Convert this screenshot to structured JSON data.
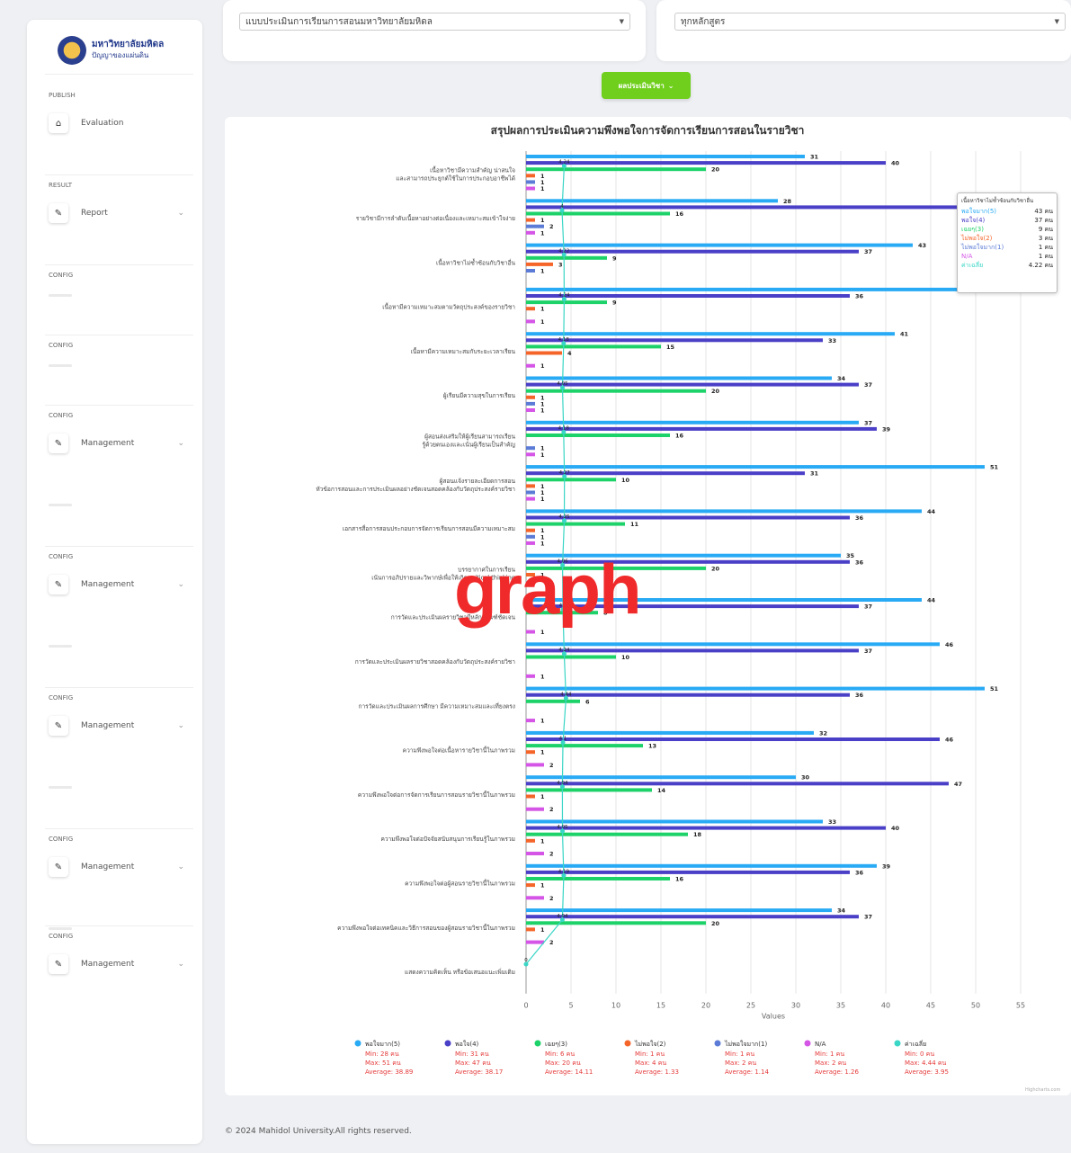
{
  "sidebar": {
    "logo_title": "มหาวิทยาลัยมหิดล",
    "logo_sub": "ปัญญาของแผ่นดิน",
    "sections": [
      {
        "label": "PUBLISH",
        "item": "Evaluation",
        "icon": "home-icon",
        "chevron": false,
        "ghost": false
      },
      {
        "label": "RESULT",
        "item": "Report",
        "icon": "tool-icon",
        "chevron": true,
        "ghost": false
      },
      {
        "label": "CONFIG",
        "item": "",
        "icon": "",
        "chevron": false,
        "ghost": true
      },
      {
        "label": "CONFIG",
        "item": "",
        "icon": "",
        "chevron": false,
        "ghost": true
      },
      {
        "label": "CONFIG",
        "item": "Management",
        "icon": "tool-icon",
        "chevron": true,
        "ghost": true
      },
      {
        "label": "CONFIG",
        "item": "Management",
        "icon": "tool-icon",
        "chevron": true,
        "ghost": true
      },
      {
        "label": "CONFIG",
        "item": "Management",
        "icon": "tool-icon",
        "chevron": true,
        "ghost": true
      },
      {
        "label": "CONFIG",
        "item": "Management",
        "icon": "tool-icon",
        "chevron": true,
        "ghost": true
      },
      {
        "label": "CONFIG",
        "item": "Management",
        "icon": "tool-icon",
        "chevron": true,
        "ghost": false
      }
    ]
  },
  "filters": {
    "form_select": "แบบประเมินการเรียนการสอนมหาวิทยาลัยมหิดล",
    "course_select": "ทุกหลักสูตร"
  },
  "button_label": "ผลประเมินวิชา",
  "overlay_text": "graph",
  "footer": "© 2024 Mahidol University.All rights reserved.",
  "credit": "Highcharts.com",
  "tooltip": {
    "title": "เนื้อหาวิชาไม่ซ้ำซ้อนกับวิชาอื่น",
    "rows": [
      {
        "label": "พอใจมาก(5)",
        "value": "43 คน",
        "color": "#29aaf4"
      },
      {
        "label": "พอใจ(4)",
        "value": "37 คน",
        "color": "#4a3fc7"
      },
      {
        "label": "เฉยๆ(3)",
        "value": "9 คน",
        "color": "#1ed26a"
      },
      {
        "label": "ไม่พอใจ(2)",
        "value": "3 คน",
        "color": "#f5652a"
      },
      {
        "label": "ไม่พอใจมาก(1)",
        "value": "1 คน",
        "color": "#5b7bd6"
      },
      {
        "label": "N/A",
        "value": "1 คน",
        "color": "#d455e6"
      },
      {
        "label": "ค่าเฉลี่ย",
        "value": "4.22 คน",
        "color": "#3ad6c6"
      }
    ]
  },
  "chart_data": {
    "type": "bar",
    "title": "สรุปผลการประเมินความพึงพอใจการจัดการเรียนการสอนในรายวิชา",
    "xlabel": "Values",
    "xlim": [
      0,
      55
    ],
    "xticks": [
      0,
      5,
      10,
      15,
      20,
      25,
      30,
      35,
      40,
      45,
      50,
      55
    ],
    "categories": [
      "เนื้อหาวิชามีความสำคัญ น่าสนใจ และสามารถประยุกต์ใช้ในการประกอบอาชีพได้",
      "รายวิชามีการลำดับเนื้อหาอย่างต่อเนื่องและเหมาะสมเข้าใจง่าย",
      "เนื้อหาวิชาไม่ซ้ำซ้อนกับวิชาอื่น",
      "เนื้อหามีความเหมาะสมตามวัตถุประสงค์ของรายวิชา",
      "เนื้อหามีความเหมาะสมกับระยะเวลาเรียน",
      "ผู้เรียนมีความสุขในการเรียน",
      "ผู้สอนส่งเสริมให้ผู้เรียนสามารถเรียนรู้ด้วยตนเองและเน้นผู้เรียนเป็นสำคัญ",
      "ผู้สอนแจ้งรายละเอียดการสอน หัวข้อการสอนและการประเมินผลอย่างชัดเจนสอดคล้องกับวัตถุประสงค์รายวิชา",
      "เอกสารสื่อการสอนประกอบการจัดการเรียนการสอนมีความเหมาะสม",
      "บรรยากาศในการเรียน เน้นการอภิปรายและวิพากษ์เพื่อให้เกิด critical thinking",
      "การวัดและประเมินผลรายวิชามีหลักเกณฑ์ชัดเจน",
      "การวัดและประเมินผลรายวิชาสอดคล้องกับวัตถุประสงค์รายวิชา",
      "การวัดและประเมินผลการศึกษา มีความเหมาะสมและเที่ยงตรง",
      "ความพึงพอใจต่อเนื้อหารายวิชานี้ในภาพรวม",
      "ความพึงพอใจต่อการจัดการเรียนการสอนรายวิชานี้ในภาพรวม",
      "ความพึงพอใจต่อปัจจัยสนับสนุนการเรียนรู้ในภาพรวม",
      "ความพึงพอใจต่อผู้สอนรายวิชานี้ในภาพรวม",
      "ความพึงพอใจต่อเทคนิคและวิธีการสอนของผู้สอนรายวิชานี้ในภาพรวม",
      "แสดงความคิดเห็น หรือข้อเสนอแนะเพิ่มเติม"
    ],
    "series": [
      {
        "name": "พอใจมาก(5)",
        "color": "#29aaf4",
        "values": [
          31,
          28,
          43,
          52,
          41,
          34,
          37,
          51,
          44,
          35,
          44,
          46,
          51,
          32,
          30,
          33,
          39,
          34,
          null
        ]
      },
      {
        "name": "พอใจ(4)",
        "color": "#4a3fc7",
        "values": [
          40,
          55,
          37,
          36,
          33,
          37,
          39,
          31,
          36,
          36,
          37,
          37,
          36,
          46,
          47,
          40,
          36,
          37,
          null
        ]
      },
      {
        "name": "เฉยๆ(3)",
        "color": "#1ed26a",
        "values": [
          20,
          16,
          9,
          9,
          15,
          20,
          16,
          10,
          11,
          20,
          8,
          10,
          6,
          13,
          14,
          18,
          16,
          20,
          null
        ]
      },
      {
        "name": "ไม่พอใจ(2)",
        "color": "#f5652a",
        "values": [
          1,
          1,
          3,
          1,
          4,
          1,
          null,
          1,
          1,
          1,
          null,
          null,
          null,
          1,
          1,
          1,
          1,
          1,
          null
        ]
      },
      {
        "name": "ไม่พอใจมาก(1)",
        "color": "#5b7bd6",
        "values": [
          1,
          2,
          1,
          null,
          null,
          1,
          1,
          1,
          1,
          null,
          null,
          null,
          null,
          null,
          null,
          null,
          null,
          null,
          null
        ]
      },
      {
        "name": "N/A",
        "color": "#d455e6",
        "values": [
          1,
          1,
          null,
          1,
          1,
          1,
          1,
          1,
          1,
          null,
          1,
          1,
          1,
          2,
          2,
          2,
          2,
          2,
          null
        ]
      },
      {
        "name": "ค่าเฉลี่ย",
        "color": "#3ad6c6",
        "type": "line",
        "values": [
          4.24,
          4.0,
          4.22,
          4.24,
          4.18,
          4.05,
          4.18,
          4.27,
          4.25,
          4.06,
          4.1,
          4.24,
          4.44,
          4.1,
          4.04,
          4.05,
          4.19,
          4.04,
          0
        ]
      }
    ],
    "legend": [
      {
        "name": "พอใจมาก(5)",
        "color": "#29aaf4",
        "min": "Min: 28 คน",
        "max": "Max: 51 คน",
        "avg": "Average: 38.89"
      },
      {
        "name": "พอใจ(4)",
        "color": "#4a3fc7",
        "min": "Min: 31 คน",
        "max": "Max: 47 คน",
        "avg": "Average: 38.17"
      },
      {
        "name": "เฉยๆ(3)",
        "color": "#1ed26a",
        "min": "Min: 6 คน",
        "max": "Max: 20 คน",
        "avg": "Average: 14.11"
      },
      {
        "name": "ไม่พอใจ(2)",
        "color": "#f5652a",
        "min": "Min: 1 คน",
        "max": "Max: 4 คน",
        "avg": "Average: 1.33"
      },
      {
        "name": "ไม่พอใจมาก(1)",
        "color": "#5b7bd6",
        "min": "Min: 1 คน",
        "max": "Max: 2 คน",
        "avg": "Average: 1.14"
      },
      {
        "name": "N/A",
        "color": "#d455e6",
        "min": "Min: 1 คน",
        "max": "Max: 2 คน",
        "avg": "Average: 1.26"
      },
      {
        "name": "ค่าเฉลี่ย",
        "color": "#3ad6c6",
        "min": "Min: 0 คน",
        "max": "Max: 4.44 คน",
        "avg": "Average: 3.95"
      }
    ],
    "legend_placement": "bottom"
  }
}
